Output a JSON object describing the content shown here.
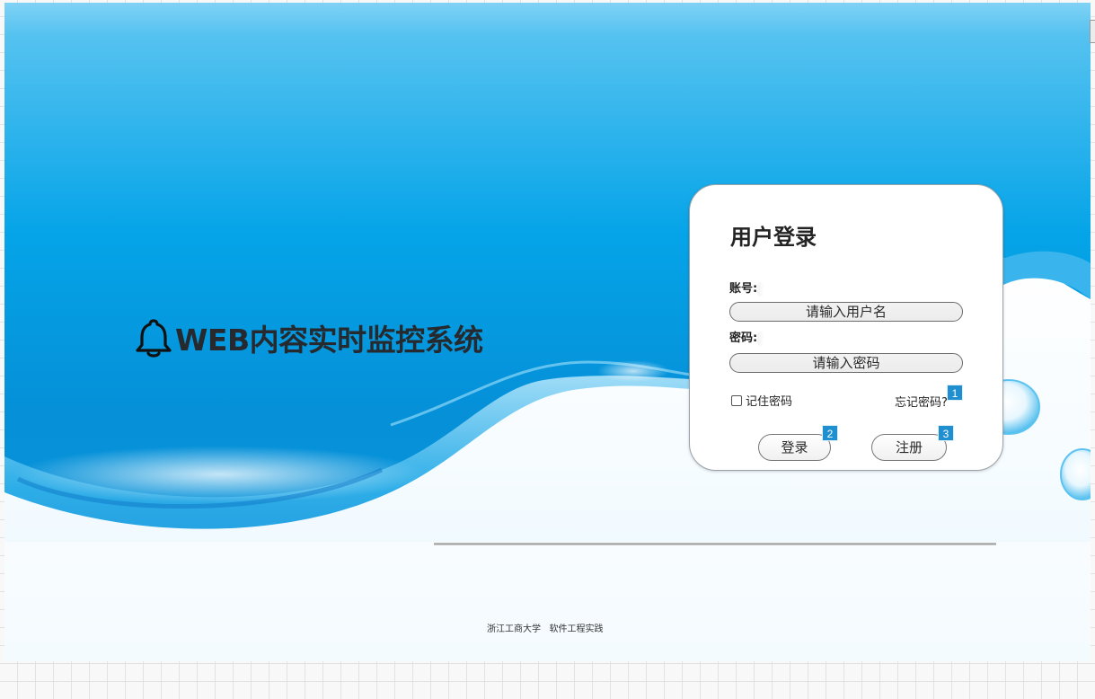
{
  "system": {
    "title": "WEB内容实时监控系统",
    "icon": "bell-icon"
  },
  "login": {
    "title": "用户登录",
    "account_label": "账号:",
    "username_placeholder": "请输入用户名",
    "password_label": "密码:",
    "password_placeholder": "请输入密码",
    "remember_label": "记住密码",
    "forgot_label": "忘记密码?",
    "login_button": "登录",
    "register_button": "注册"
  },
  "badges": {
    "forgot": "1",
    "login": "2",
    "register": "3"
  },
  "footer": {
    "text": "浙江工商大学   软件工程实践"
  },
  "colors": {
    "accent_blue": "#0a9be0",
    "badge_blue": "#1f8fd0",
    "title_dark": "#262a2e"
  }
}
